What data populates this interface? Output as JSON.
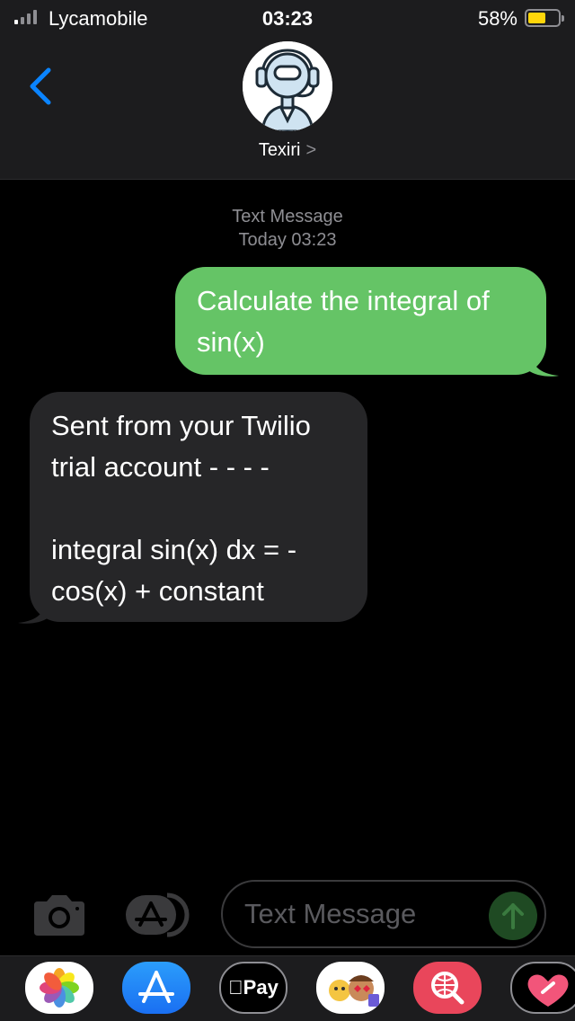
{
  "status_bar": {
    "carrier": "Lycamobile",
    "time": "03:23",
    "battery_percent_label": "58%",
    "battery_level": 0.58,
    "battery_color": "#ffd60a"
  },
  "header": {
    "back_icon": "chevron-left-icon",
    "contact_name": "Texiri",
    "contact_chevron": ">",
    "avatar_icon": "robot-headset-avatar"
  },
  "conversation": {
    "service_label": "Text Message",
    "timestamp": "Today 03:23",
    "messages": [
      {
        "direction": "sent",
        "text": "Calculate the integral of sin(x)",
        "color": "#65c466"
      },
      {
        "direction": "received",
        "text": "Sent from your Twilio trial account - - - -\n\nintegral sin(x) dx = -cos(x) + constant",
        "color": "#262628"
      }
    ]
  },
  "input_bar": {
    "camera_icon": "camera-icon",
    "apps_icon": "app-store-icon",
    "placeholder": "Text Message",
    "send_icon": "arrow-up-icon"
  },
  "app_drawer": {
    "apps": [
      {
        "name": "Photos",
        "icon": "photos-flower-icon"
      },
      {
        "name": "App Store",
        "icon": "app-store-icon"
      },
      {
        "name": "Apple Pay",
        "label": "Pay",
        "icon": "apple-logo-icon"
      },
      {
        "name": "Memoji",
        "icon": "memoji-icon"
      },
      {
        "name": "Search",
        "icon": "globe-search-icon"
      },
      {
        "name": "Digital Touch",
        "icon": "heart-icon"
      }
    ]
  }
}
